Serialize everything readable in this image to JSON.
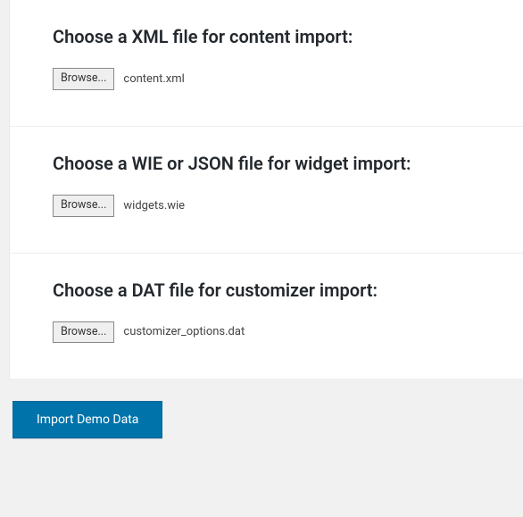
{
  "sections": {
    "content": {
      "title": "Choose a XML file for content import:",
      "browse_label": "Browse...",
      "file_name": "content.xml"
    },
    "widget": {
      "title": "Choose a WIE or JSON file for widget import:",
      "browse_label": "Browse...",
      "file_name": "widgets.wie"
    },
    "customizer": {
      "title": "Choose a DAT file for customizer import:",
      "browse_label": "Browse...",
      "file_name": "customizer_options.dat"
    }
  },
  "actions": {
    "import_label": "Import Demo Data"
  }
}
